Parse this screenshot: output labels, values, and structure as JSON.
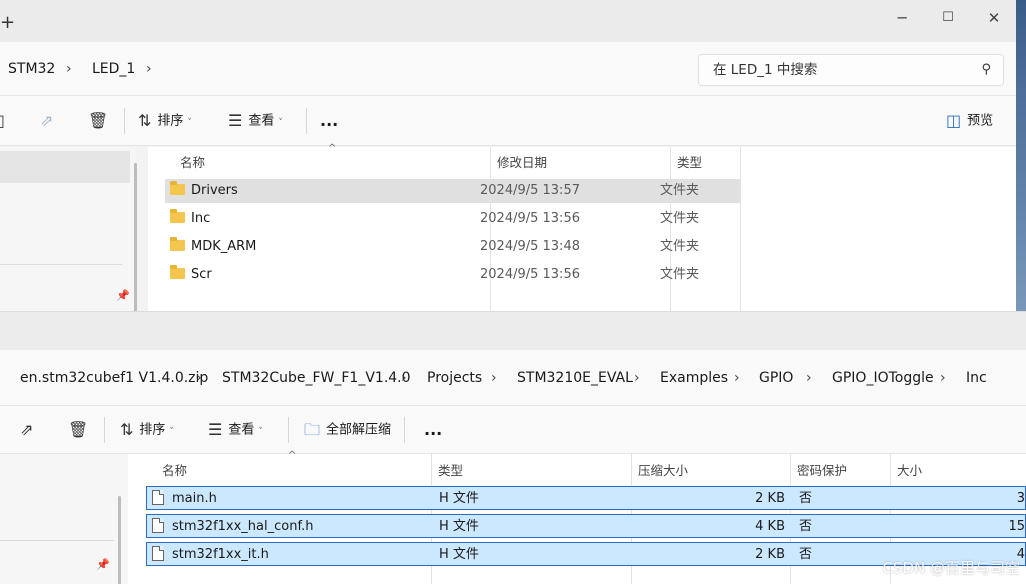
{
  "window1": {
    "breadcrumbs": [
      "STM32",
      "LED_1"
    ],
    "search_placeholder": "在 LED_1 中搜索",
    "toolbar": {
      "sort": "排序",
      "view": "查看",
      "more": "...",
      "preview": "预览"
    },
    "columns": [
      "名称",
      "修改日期",
      "类型"
    ],
    "rows": [
      {
        "name": "Drivers",
        "date": "2024/9/5 13:57",
        "type": "文件夹",
        "selected": true
      },
      {
        "name": "Inc",
        "date": "2024/9/5 13:56",
        "type": "文件夹",
        "selected": false
      },
      {
        "name": "MDK_ARM",
        "date": "2024/9/5 13:48",
        "type": "文件夹",
        "selected": false
      },
      {
        "name": "Scr",
        "date": "2024/9/5 13:56",
        "type": "文件夹",
        "selected": false
      }
    ]
  },
  "window2": {
    "breadcrumbs": [
      "en.stm32cubef1 V1.4.0.zip",
      "STM32Cube_FW_F1_V1.4.0",
      "Projects",
      "STM3210E_EVAL",
      "Examples",
      "GPIO",
      "GPIO_IOToggle",
      "Inc"
    ],
    "toolbar": {
      "sort": "排序",
      "view": "查看",
      "extract_all": "全部解压缩",
      "more": "..."
    },
    "columns": [
      "名称",
      "类型",
      "压缩大小",
      "密码保护",
      "大小"
    ],
    "rows": [
      {
        "name": "main.h",
        "type": "H 文件",
        "compressed": "2 KB",
        "password": "否",
        "size": "3"
      },
      {
        "name": "stm32f1xx_hal_conf.h",
        "type": "H 文件",
        "compressed": "4 KB",
        "password": "否",
        "size": "15"
      },
      {
        "name": "stm32f1xx_it.h",
        "type": "H 文件",
        "compressed": "2 KB",
        "password": "否",
        "size": "4"
      }
    ]
  },
  "watermark": "CSDN @百里与司空",
  "icons": [
    "add-icon",
    "minimize-icon",
    "maximize-icon",
    "close-icon",
    "chevron-right-icon",
    "search-icon",
    "share-icon",
    "delete-icon",
    "sort-icon",
    "view-icon",
    "more-icon",
    "preview-pane-icon",
    "folder-icon",
    "file-icon",
    "pin-icon",
    "sort-arrow-icon",
    "zip-extract-icon"
  ],
  "colors": {
    "selection": "#cce8ff",
    "selection_border": "#2a6ac2",
    "folder": "#f4c64d"
  }
}
